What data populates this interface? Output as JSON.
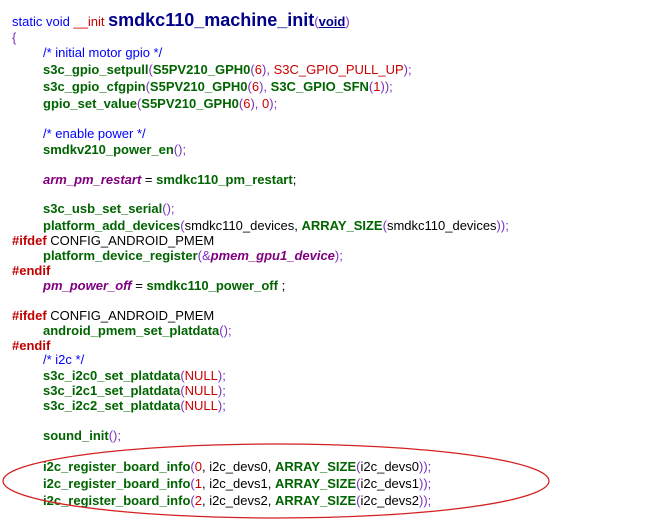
{
  "header": {
    "static": "static",
    "void": "void",
    "init": "__init",
    "fname": "smdkc110_machine_init",
    "lp": "(",
    "arg": "void",
    "rp": ")"
  },
  "brace_open": "{",
  "c1": "/* initial motor gpio */",
  "l1": {
    "fn": "s3c_gpio_setpull",
    "p1": "(",
    "a1": "S5PV210_GPH0",
    "p2": "(",
    "n": "6",
    "p3": "),",
    "sp": " ",
    "a2": "S3C_GPIO_PULL_UP",
    "p4": ");"
  },
  "l2": {
    "fn": "s3c_gpio_cfgpin",
    "p1": "(",
    "a1": "S5PV210_GPH0",
    "p2": "(",
    "n": "6",
    "p3": "),",
    "sp": " ",
    "a2": "S3C_GPIO_SFN",
    "p4": "(",
    "n2": "1",
    "p5": "));"
  },
  "l3": {
    "fn": "gpio_set_value",
    "p1": "(",
    "a1": "S5PV210_GPH0",
    "p2": "(",
    "n": "6",
    "p3": "),",
    "sp": " ",
    "n2": "0",
    "p4": ");"
  },
  "c2": "/* enable power */",
  "l4": {
    "fn": "smdkv210_power_en",
    "p1": "();"
  },
  "l5": {
    "var": "arm_pm_restart",
    "eq": " = ",
    "val": "smdkc110_pm_restart",
    "end": ";"
  },
  "l6": {
    "fn": "s3c_usb_set_serial",
    "p1": "();"
  },
  "l7": {
    "fn": "platform_add_devices",
    "p1": "(",
    "a1": "smdkc110_devices, ",
    "m": "ARRAY_SIZE",
    "p2": "(",
    "a2": "smdkc110_devices",
    "p3": "));"
  },
  "pp1": {
    "dir": "#ifdef",
    "arg": " CONFIG_ANDROID_PMEM"
  },
  "l8": {
    "fn": "platform_device_register",
    "p1": "(",
    "amp": "&",
    "var": "pmem_gpu1_device",
    "p2": ");"
  },
  "endif": "#endif",
  "l9": {
    "var": "pm_power_off",
    "eq": " = ",
    "val": "smdkc110_power_off",
    "end": " ;"
  },
  "pp2": {
    "dir": "#ifdef",
    "arg": " CONFIG_ANDROID_PMEM"
  },
  "l10": {
    "fn": "android_pmem_set_platdata",
    "p1": "();"
  },
  "c3": "/* i2c */",
  "i2c": [
    {
      "fn": "s3c_i2c0_set_platdata",
      "p1": "(",
      "n": "NULL",
      "p2": ");"
    },
    {
      "fn": "s3c_i2c1_set_platdata",
      "p1": "(",
      "n": "NULL",
      "p2": ");"
    },
    {
      "fn": "s3c_i2c2_set_platdata",
      "p1": "(",
      "n": "NULL",
      "p2": ");"
    }
  ],
  "l11": {
    "fn": "sound_init",
    "p1": "();"
  },
  "reg": [
    {
      "fn": "i2c_register_board_info",
      "p1": "(",
      "n": "0",
      "a": ", i2c_devs0, ",
      "m": "ARRAY_SIZE",
      "p2": "(",
      "a2": "i2c_devs0",
      "p3": "));"
    },
    {
      "fn": "i2c_register_board_info",
      "p1": "(",
      "n": "1",
      "a": ", i2c_devs1, ",
      "m": "ARRAY_SIZE",
      "p2": "(",
      "a2": "i2c_devs1",
      "p3": "));"
    },
    {
      "fn": "i2c_register_board_info",
      "p1": "(",
      "n": "2",
      "a": ", i2c_devs2, ",
      "m": "ARRAY_SIZE",
      "p2": "(",
      "a2": "i2c_devs2",
      "p3": "));"
    }
  ],
  "colors": {
    "highlight_oval": "#d42020"
  }
}
